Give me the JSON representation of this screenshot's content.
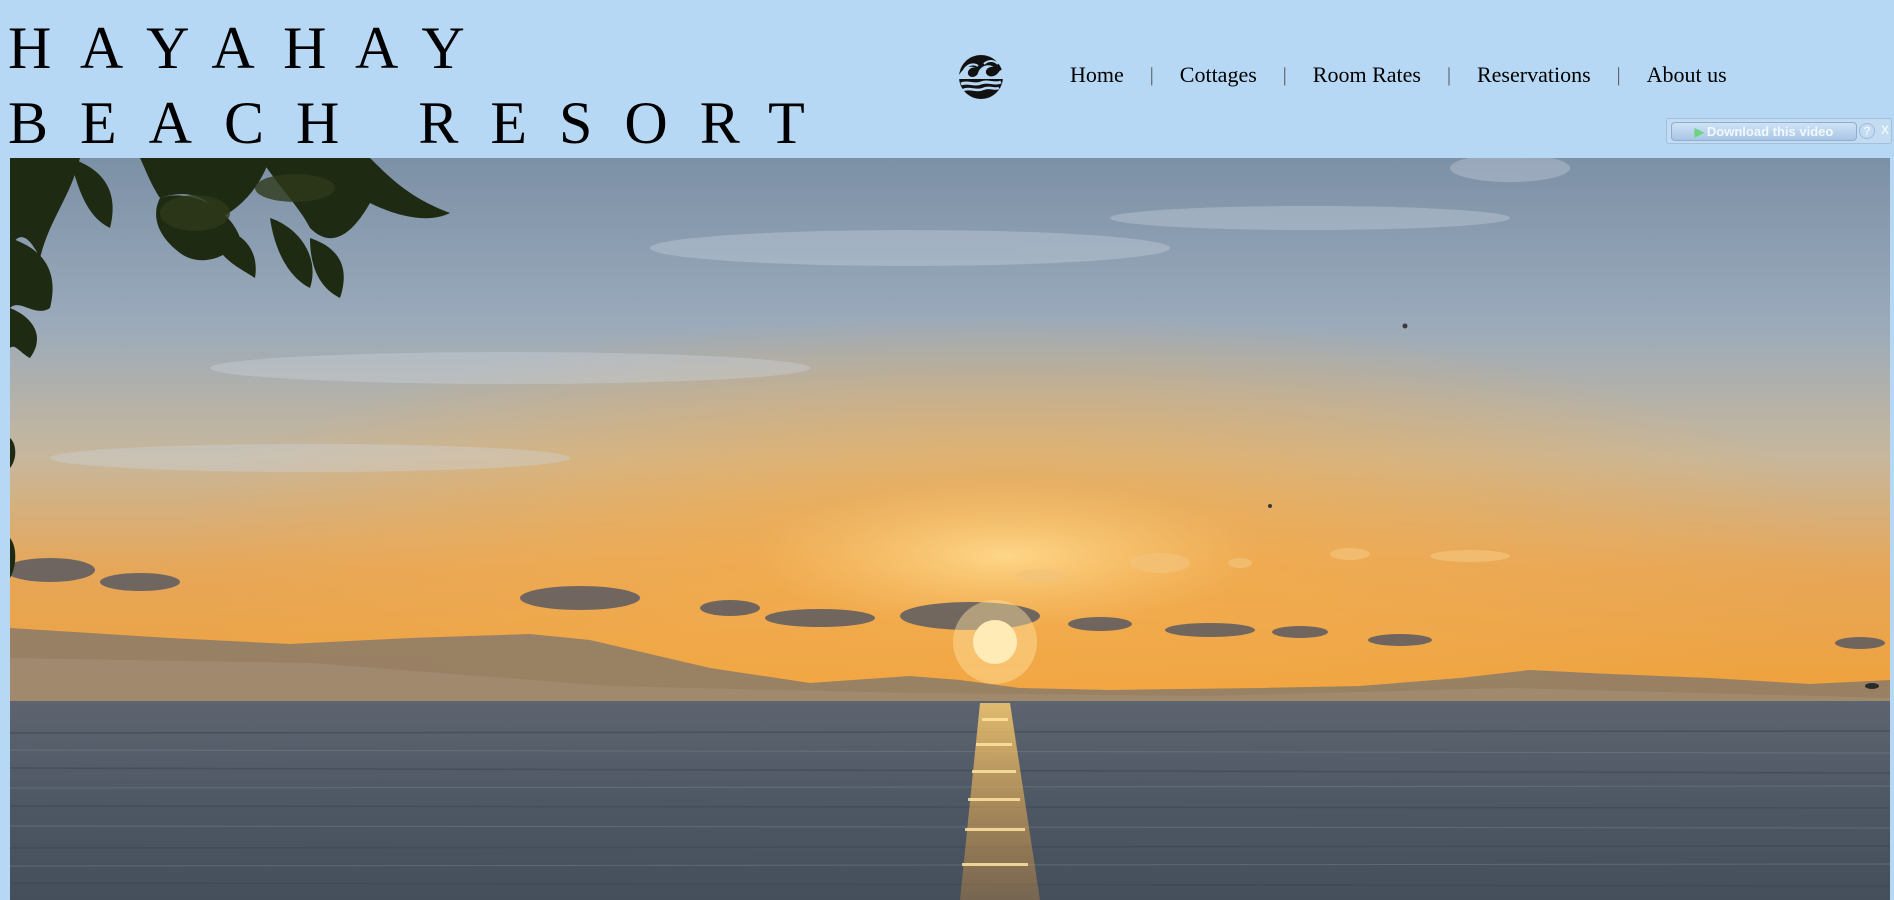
{
  "header": {
    "title_line1": "HAYAHAY",
    "title_line2": "BEACH RESORT",
    "logo_icon": "wave-sun-icon"
  },
  "nav": {
    "items": [
      {
        "label": "Home"
      },
      {
        "label": "Cottages"
      },
      {
        "label": "Room Rates"
      },
      {
        "label": "Reservations"
      },
      {
        "label": "About us"
      }
    ],
    "separator": "|"
  },
  "download_bar": {
    "button_label": "Download this video",
    "play_icon": "play-icon",
    "help_label": "?",
    "close_label": "X"
  },
  "video": {
    "scene": "sunset-over-sea"
  },
  "colors": {
    "page_background": "#b7d8f4",
    "text": "#000000"
  }
}
